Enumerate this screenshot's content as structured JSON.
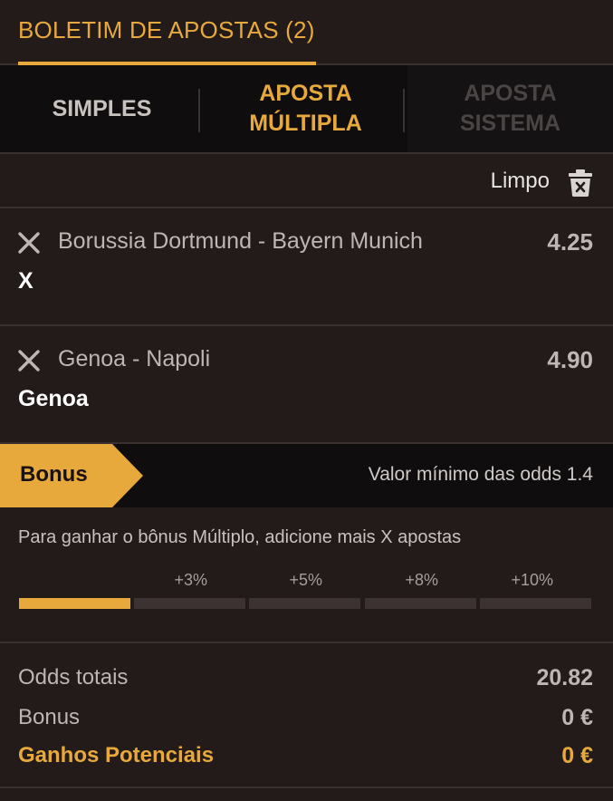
{
  "header": {
    "title": "BOLETIM DE APOSTAS (2)"
  },
  "tabs": [
    {
      "line1": "SIMPLES",
      "line2": ""
    },
    {
      "line1": "APOSTA",
      "line2": "MÚLTIPLA"
    },
    {
      "line1": "APOSTA",
      "line2": "SISTEMA"
    }
  ],
  "clear": {
    "label": "Limpo",
    "icon": "trash-icon"
  },
  "bets": [
    {
      "match": "Borussia Dortmund - Bayern Munich",
      "odds": "4.25",
      "pick": "X"
    },
    {
      "match": "Genoa - Napoli",
      "odds": "4.90",
      "pick": "Genoa"
    }
  ],
  "bonus": {
    "tag": "Bonus",
    "min_odds": "Valor mínimo das odds 1.4",
    "info": "Para ganhar o bônus Múltiplo, adicione mais X apostas",
    "steps": [
      {
        "label": "",
        "filled": true
      },
      {
        "label": "+3%",
        "filled": false
      },
      {
        "label": "+5%",
        "filled": false
      },
      {
        "label": "+8%",
        "filled": false
      },
      {
        "label": "+10%",
        "filled": false
      }
    ]
  },
  "totals": {
    "odds_label": "Odds totais",
    "odds_value": "20.82",
    "bonus_label": "Bonus",
    "bonus_value": "0 €",
    "gain_label": "Ganhos Potenciais",
    "gain_value": "0 €"
  },
  "colors": {
    "accent": "#e8a93c",
    "background": "#231a1a",
    "dark": "#0f0d0d"
  }
}
